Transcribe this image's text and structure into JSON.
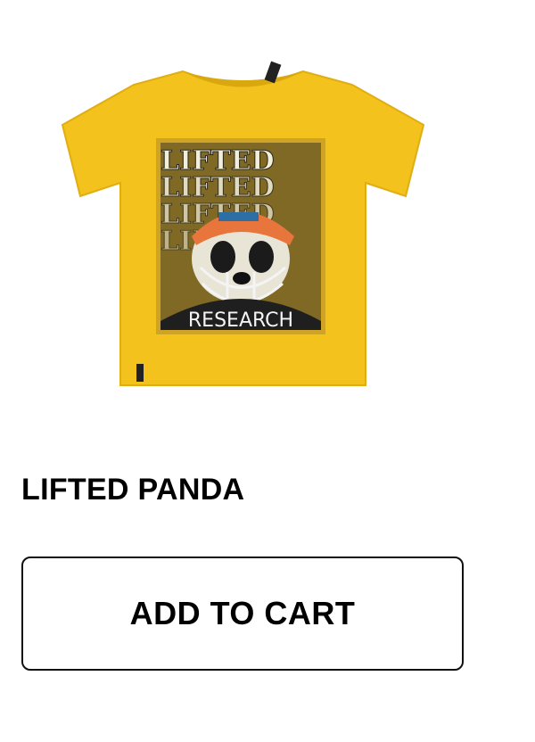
{
  "product": {
    "title": "LIFTED PANDA",
    "graphic": {
      "headline": "LIFTED",
      "caption": "RESEARCH"
    }
  },
  "cart": {
    "add_label": "ADD TO CART"
  },
  "colors": {
    "shirt": "#f3c21d",
    "shirt_shadow": "#d9a80f",
    "text": "#000000"
  }
}
